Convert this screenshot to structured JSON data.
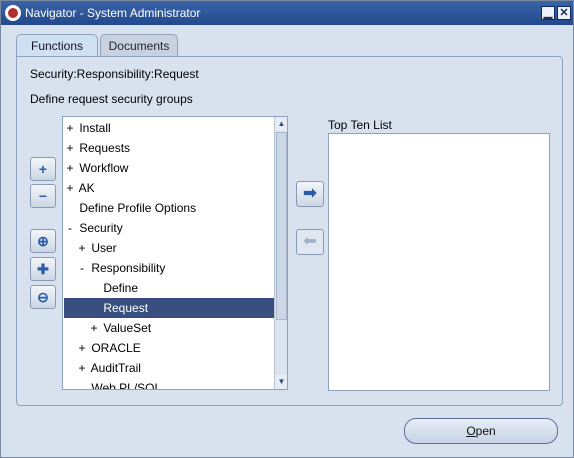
{
  "window": {
    "title": "Navigator - System Administrator",
    "min_glyph": "▁",
    "close_glyph": "✕"
  },
  "tabs": [
    {
      "label": "Functions",
      "active": true
    },
    {
      "label": "Documents",
      "active": false
    }
  ],
  "path": "Security:Responsibility:Request",
  "description": "Define request security groups",
  "tree": {
    "items": [
      {
        "exp": "+",
        "label": "Install",
        "indent": 0
      },
      {
        "exp": "+",
        "label": "Requests",
        "indent": 0
      },
      {
        "exp": "+",
        "label": "Workflow",
        "indent": 0
      },
      {
        "exp": "+",
        "label": "AK",
        "indent": 0
      },
      {
        "exp": "",
        "label": "Define Profile Options",
        "indent": 0
      },
      {
        "exp": "-",
        "label": "Security",
        "indent": 0
      },
      {
        "exp": "+",
        "label": "User",
        "indent": 1
      },
      {
        "exp": "-",
        "label": "Responsibility",
        "indent": 1
      },
      {
        "exp": "",
        "label": "Define",
        "indent": 2
      },
      {
        "exp": "",
        "label": "Request",
        "indent": 2,
        "selected": true
      },
      {
        "exp": "+",
        "label": "ValueSet",
        "indent": 2
      },
      {
        "exp": "+",
        "label": "ORACLE",
        "indent": 1
      },
      {
        "exp": "+",
        "label": "AuditTrail",
        "indent": 1
      },
      {
        "exp": "",
        "label": "Web PL/SQL",
        "indent": 1
      }
    ]
  },
  "side_buttons": [
    {
      "name": "expand-button",
      "glyph": "+",
      "icon": "plus-icon"
    },
    {
      "name": "collapse-button",
      "glyph": "−",
      "icon": "minus-icon"
    },
    {
      "name": "expand-branch-button",
      "glyph": "⊕",
      "icon": "expand-branch-icon"
    },
    {
      "name": "expand-all-button",
      "glyph": "✚",
      "icon": "expand-all-icon"
    },
    {
      "name": "collapse-all-button",
      "glyph": "⊖",
      "icon": "collapse-all-icon"
    }
  ],
  "move_buttons": {
    "add_glyph": "➡",
    "remove_glyph": "⬅"
  },
  "top_ten": {
    "label": "Top Ten List",
    "items": []
  },
  "open_button": {
    "label_first": "O",
    "label_rest": "pen"
  }
}
